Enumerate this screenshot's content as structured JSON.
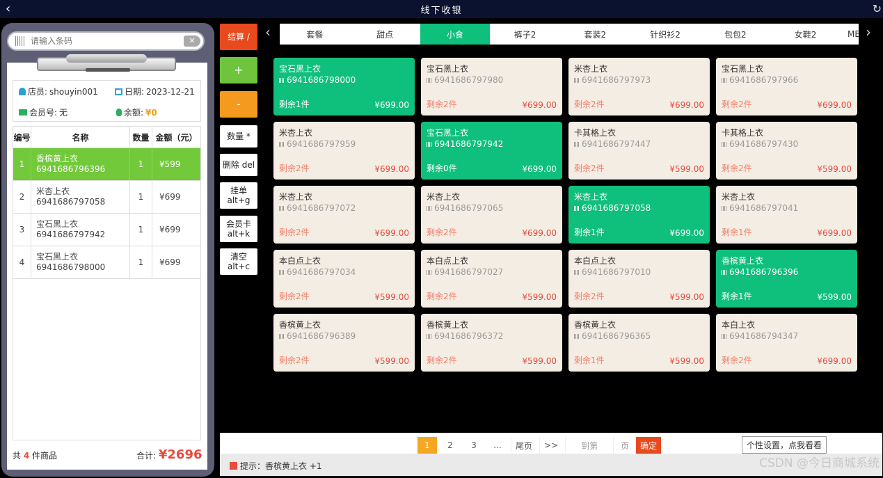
{
  "titlebar": {
    "title": "线下收银",
    "back_icon": "chevron-left-icon",
    "refresh_icon": "refresh-icon"
  },
  "search": {
    "placeholder": "请输入条码"
  },
  "info": {
    "cashier_label": "店员:",
    "cashier": "shouyin001",
    "date_label": "日期:",
    "date": "2023-12-21",
    "member_label": "会员号:",
    "member": "无",
    "balance_label": "余额:",
    "balance": "¥0"
  },
  "table": {
    "headers": [
      "编号",
      "名称",
      "数量",
      "金额（元）"
    ],
    "rows": [
      {
        "no": "1",
        "name": "香槟黄上衣",
        "code": "6941686796396",
        "qty": "1",
        "amount": "¥599"
      },
      {
        "no": "2",
        "name": "米杏上衣",
        "code": "6941686797058",
        "qty": "1",
        "amount": "¥699"
      },
      {
        "no": "3",
        "name": "宝石黑上衣",
        "code": "6941686797942",
        "qty": "1",
        "amount": "¥699"
      },
      {
        "no": "4",
        "name": "宝石黑上衣",
        "code": "6941686798000",
        "qty": "1",
        "amount": "¥699"
      }
    ]
  },
  "summary": {
    "count_prefix": "共",
    "count": "4",
    "count_suffix": "件商品",
    "total_label": "合计:",
    "total": "¥2696"
  },
  "actions": {
    "checkout": "结算 /",
    "plus": "+",
    "minus": "-",
    "qty": "数量 *",
    "delete": "删除 del",
    "hold_1": "挂单",
    "hold_2": "alt+g",
    "member_1": "会员卡",
    "member_2": "alt+k",
    "clear_1": "清空",
    "clear_2": "alt+c"
  },
  "tabs": [
    "套餐",
    "甜点",
    "小食",
    "裤子2",
    "套装2",
    "针织衫2",
    "包包2",
    "女鞋2",
    "ME"
  ],
  "products": [
    {
      "name": "宝石黑上衣",
      "code": "6941686798000",
      "stock": "剩余1件",
      "price": "¥699.00"
    },
    {
      "name": "宝石黑上衣",
      "code": "6941686797980",
      "stock": "剩余2件",
      "price": "¥699.00"
    },
    {
      "name": "米杏上衣",
      "code": "6941686797973",
      "stock": "剩余2件",
      "price": "¥699.00"
    },
    {
      "name": "宝石黑上衣",
      "code": "6941686797966",
      "stock": "剩余2件",
      "price": "¥699.00"
    },
    {
      "name": "米杏上衣",
      "code": "6941686797959",
      "stock": "剩余2件",
      "price": "¥699.00"
    },
    {
      "name": "宝石黑上衣",
      "code": "6941686797942",
      "stock": "剩余0件",
      "price": "¥699.00"
    },
    {
      "name": "卡其格上衣",
      "code": "6941686797447",
      "stock": "剩余2件",
      "price": "¥599.00"
    },
    {
      "name": "卡其格上衣",
      "code": "6941686797430",
      "stock": "剩余2件",
      "price": "¥599.00"
    },
    {
      "name": "米杏上衣",
      "code": "6941686797072",
      "stock": "剩余2件",
      "price": "¥699.00"
    },
    {
      "name": "米杏上衣",
      "code": "6941686797065",
      "stock": "剩余2件",
      "price": "¥699.00"
    },
    {
      "name": "米杏上衣",
      "code": "6941686797058",
      "stock": "剩余1件",
      "price": "¥699.00"
    },
    {
      "name": "米杏上衣",
      "code": "6941686797041",
      "stock": "剩余1件",
      "price": "¥699.00"
    },
    {
      "name": "本白点上衣",
      "code": "6941686797034",
      "stock": "剩余2件",
      "price": "¥599.00"
    },
    {
      "name": "本白点上衣",
      "code": "6941686797027",
      "stock": "剩余2件",
      "price": "¥599.00"
    },
    {
      "name": "本白点上衣",
      "code": "6941686797010",
      "stock": "剩余2件",
      "price": "¥599.00"
    },
    {
      "name": "香槟黄上衣",
      "code": "6941686796396",
      "stock": "剩余1件",
      "price": "¥599.00"
    },
    {
      "name": "香槟黄上衣",
      "code": "6941686796389",
      "stock": "剩余2件",
      "price": "¥599.00"
    },
    {
      "name": "香槟黄上衣",
      "code": "6941686796372",
      "stock": "剩余2件",
      "price": "¥599.00"
    },
    {
      "name": "香槟黄上衣",
      "code": "6941686796365",
      "stock": "剩余1件",
      "price": "¥599.00"
    },
    {
      "name": "本白上衣",
      "code": "6941686794347",
      "stock": "剩余2件",
      "price": "¥699.00"
    }
  ],
  "pager": {
    "p1": "1",
    "p2": "2",
    "p3": "3",
    "ellipsis": "...",
    "last": "尾页",
    "next": ">>",
    "goto": "到第",
    "page": "页",
    "ok": "确定"
  },
  "tip": "提示：香槟黄上衣 +1",
  "settings": "个性设置，点我看看",
  "watermark": "CSDN @今日商城系统",
  "colors": {
    "accent_green": "#0fbf7c",
    "row_green": "#72c93a",
    "checkout_red": "#e8491d",
    "minus_orange": "#f49b1f",
    "pager_orange": "#f5a623"
  }
}
